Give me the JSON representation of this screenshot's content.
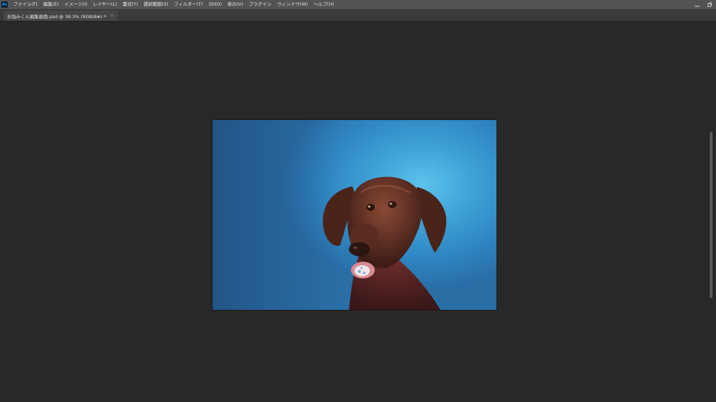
{
  "app": {
    "icon_label": "Ps"
  },
  "menu": [
    "ファイル(F)",
    "編集(E)",
    "イメージ(I)",
    "レイヤー(L)",
    "書式(Y)",
    "選択範囲(S)",
    "フィルター(T)",
    "3D(D)",
    "表示(V)",
    "プラグイン",
    "ウィンドウ(W)",
    "ヘルプ(H)"
  ],
  "window_controls": [
    "minimize-icon",
    "restore-icon"
  ],
  "document_tab": {
    "title": "お悩みくん編集画面.psd @ 38.3% (RGB/8#) *",
    "close_glyph": "×"
  },
  "canvas_image": {
    "subject": "brown dog with pacifier on blue backdrop",
    "colors": {
      "background": "#3fa3d7",
      "dog": "#5a2e22",
      "pacifier": "#e8dde0"
    }
  }
}
